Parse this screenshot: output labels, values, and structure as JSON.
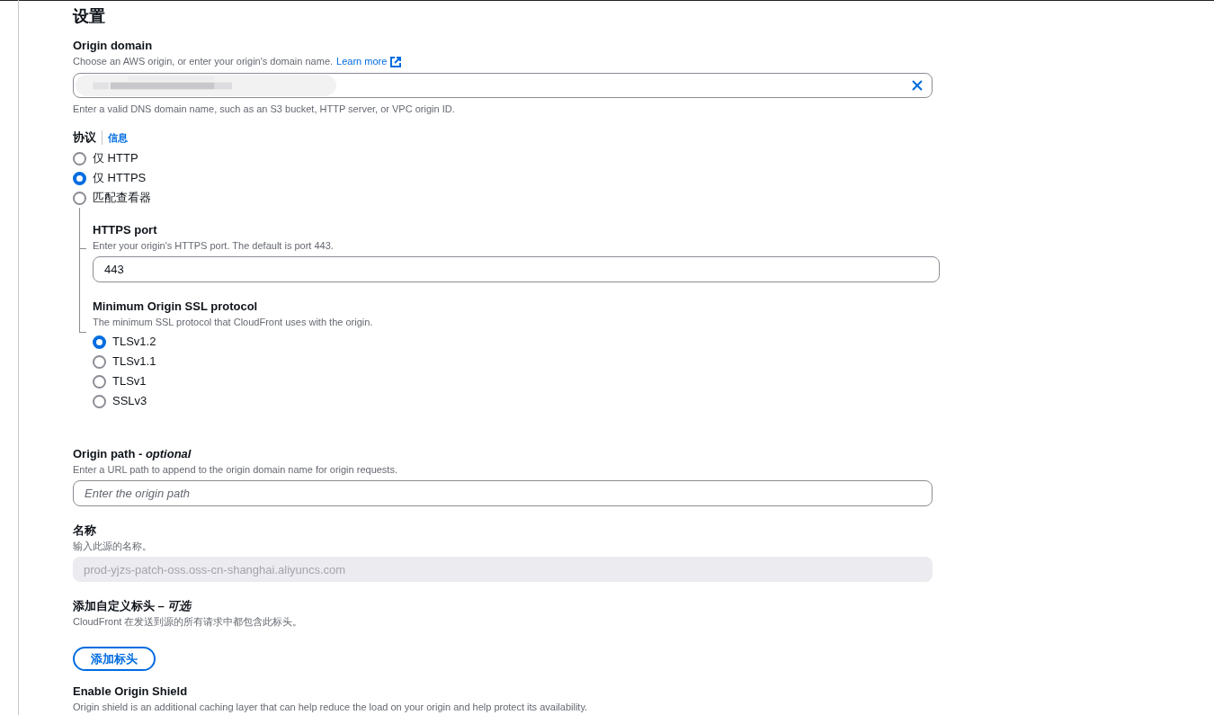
{
  "page_title": "设置",
  "origin_domain": {
    "label": "Origin domain",
    "description": "Choose an AWS origin, or enter your origin's domain name.",
    "learn_more": "Learn more",
    "hint": "Enter a valid DNS domain name, such as an S3 bucket, HTTP server, or VPC origin ID.",
    "redacted": true
  },
  "protocol": {
    "label": "协议",
    "info_link": "信息",
    "options": [
      {
        "label": "仅 HTTP",
        "selected": false
      },
      {
        "label": "仅 HTTPS",
        "selected": true
      },
      {
        "label": "匹配查看器",
        "selected": false
      }
    ]
  },
  "https_port": {
    "label": "HTTPS port",
    "description": "Enter your origin's HTTPS port. The default is port 443.",
    "value": "443"
  },
  "min_ssl": {
    "label": "Minimum Origin SSL protocol",
    "description": "The minimum SSL protocol that CloudFront uses with the origin.",
    "options": [
      {
        "label": "TLSv1.2",
        "selected": true
      },
      {
        "label": "TLSv1.1",
        "selected": false
      },
      {
        "label": "TLSv1",
        "selected": false
      },
      {
        "label": "SSLv3",
        "selected": false
      }
    ]
  },
  "origin_path": {
    "label": "Origin path - *optional*",
    "description": "Enter a URL path to append to the origin domain name for origin requests.",
    "placeholder": "Enter the origin path"
  },
  "name": {
    "label": "名称",
    "description": "输入此源的名称。",
    "value": "prod-yjzs-patch-oss.oss-cn-shanghai.aliyuncs.com",
    "disabled": true
  },
  "custom_headers": {
    "label": "添加自定义标头 – *可选*",
    "description": "CloudFront 在发送到源的所有请求中都包含此标头。",
    "button": "添加标头"
  },
  "origin_shield": {
    "label": "Enable Origin Shield",
    "description": "Origin shield is an additional caching layer that can help reduce the load on your origin and help protect its availability."
  }
}
